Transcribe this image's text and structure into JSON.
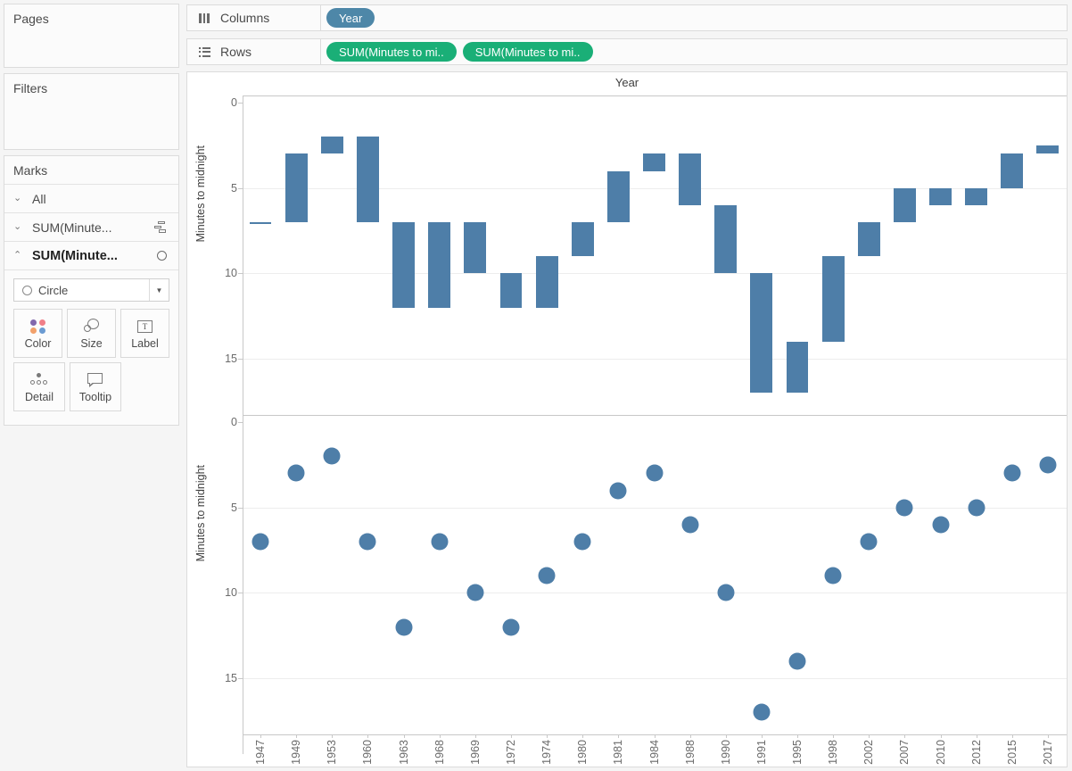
{
  "panels": {
    "pages": {
      "title": "Pages"
    },
    "filters": {
      "title": "Filters"
    },
    "marks": {
      "title": "Marks",
      "rows": [
        {
          "label": "All",
          "chevron": "⌄",
          "icon": ""
        },
        {
          "label": "SUM(Minute...",
          "chevron": "⌄",
          "icon": "gantt-bar-icon"
        },
        {
          "label": "SUM(Minute...",
          "chevron": "⌃",
          "icon": "circle-icon"
        }
      ],
      "mark_type": "Circle",
      "buttons": [
        {
          "label": "Color",
          "icon": "color-palette-icon"
        },
        {
          "label": "Size",
          "icon": "size-circles-icon"
        },
        {
          "label": "Label",
          "icon": "text-label-icon"
        },
        {
          "label": "Detail",
          "icon": "detail-dots-icon"
        },
        {
          "label": "Tooltip",
          "icon": "tooltip-bubble-icon"
        }
      ]
    }
  },
  "shelves": {
    "columns": {
      "label": "Columns",
      "icon": "columns-icon",
      "pills": [
        {
          "text": "Year",
          "color": "blue"
        }
      ]
    },
    "rows": {
      "label": "Rows",
      "icon": "rows-icon",
      "pills": [
        {
          "text": "SUM(Minutes to mi..",
          "color": "green"
        },
        {
          "text": "SUM(Minutes to mi..",
          "color": "green"
        }
      ]
    }
  },
  "colors": {
    "mark_blue": "#4e7ea8",
    "pill_blue": "#4e87a8",
    "pill_green": "#1aaf77",
    "gridline": "#ededed",
    "axis": "#c8c8c8"
  },
  "chart_data": [
    {
      "type": "bar",
      "title": "Year",
      "subtitle": "",
      "xlabel": "",
      "ylabel": "Minutes to midnight",
      "y_ticks": [
        0,
        5,
        10,
        15
      ],
      "ylim": [
        0,
        18
      ],
      "y_inverted": true,
      "grid": true,
      "legend": "none",
      "note": "Gantt / waterfall bars spanning from previous year's value to current year's value",
      "categories": [
        "1947",
        "1949",
        "1953",
        "1960",
        "1963",
        "1968",
        "1969",
        "1972",
        "1974",
        "1980",
        "1981",
        "1984",
        "1988",
        "1990",
        "1991",
        "1995",
        "1998",
        "2002",
        "2007",
        "2010",
        "2012",
        "2015",
        "2017"
      ],
      "values": [
        7,
        3,
        2,
        7,
        12,
        12,
        10,
        12,
        9,
        7,
        4,
        3,
        6,
        10,
        17,
        14,
        9,
        7,
        5,
        6,
        5,
        3,
        2.5
      ],
      "bar_spans": [
        {
          "category": "1947",
          "start": 7,
          "end": 7
        },
        {
          "category": "1949",
          "start": 3,
          "end": 7
        },
        {
          "category": "1953",
          "start": 2,
          "end": 3
        },
        {
          "category": "1960",
          "start": 2,
          "end": 7
        },
        {
          "category": "1963",
          "start": 7,
          "end": 12
        },
        {
          "category": "1968",
          "start": 7,
          "end": 12
        },
        {
          "category": "1969",
          "start": 7,
          "end": 10
        },
        {
          "category": "1972",
          "start": 10,
          "end": 12
        },
        {
          "category": "1974",
          "start": 9,
          "end": 12
        },
        {
          "category": "1980",
          "start": 7,
          "end": 9
        },
        {
          "category": "1981",
          "start": 4,
          "end": 7
        },
        {
          "category": "1984",
          "start": 3,
          "end": 4
        },
        {
          "category": "1988",
          "start": 3,
          "end": 6
        },
        {
          "category": "1990",
          "start": 6,
          "end": 10
        },
        {
          "category": "1991",
          "start": 10,
          "end": 17
        },
        {
          "category": "1995",
          "start": 14,
          "end": 17
        },
        {
          "category": "1998",
          "start": 9,
          "end": 14
        },
        {
          "category": "2002",
          "start": 7,
          "end": 9
        },
        {
          "category": "2007",
          "start": 5,
          "end": 7
        },
        {
          "category": "2010",
          "start": 5,
          "end": 6
        },
        {
          "category": "2012",
          "start": 5,
          "end": 6
        },
        {
          "category": "2015",
          "start": 3,
          "end": 5
        },
        {
          "category": "2017",
          "start": 2.5,
          "end": 3
        }
      ]
    },
    {
      "type": "scatter",
      "title": "",
      "xlabel": "",
      "ylabel": "Minutes to midnight",
      "y_ticks": [
        0,
        5,
        10,
        15
      ],
      "ylim": [
        0,
        18
      ],
      "y_inverted": true,
      "grid": true,
      "legend": "none",
      "categories": [
        "1947",
        "1949",
        "1953",
        "1960",
        "1963",
        "1968",
        "1969",
        "1972",
        "1974",
        "1980",
        "1981",
        "1984",
        "1988",
        "1990",
        "1991",
        "1995",
        "1998",
        "2002",
        "2007",
        "2010",
        "2012",
        "2015",
        "2017"
      ],
      "values": [
        7,
        3,
        2,
        7,
        12,
        7,
        10,
        12,
        9,
        7,
        4,
        3,
        6,
        10,
        17,
        14,
        9,
        7,
        5,
        6,
        5,
        3,
        2.5
      ]
    }
  ],
  "x_axis_labels": [
    "1947",
    "1949",
    "1953",
    "1960",
    "1963",
    "1968",
    "1969",
    "1972",
    "1974",
    "1980",
    "1981",
    "1984",
    "1988",
    "1990",
    "1991",
    "1995",
    "1998",
    "2002",
    "2007",
    "2010",
    "2012",
    "2015",
    "2017"
  ]
}
